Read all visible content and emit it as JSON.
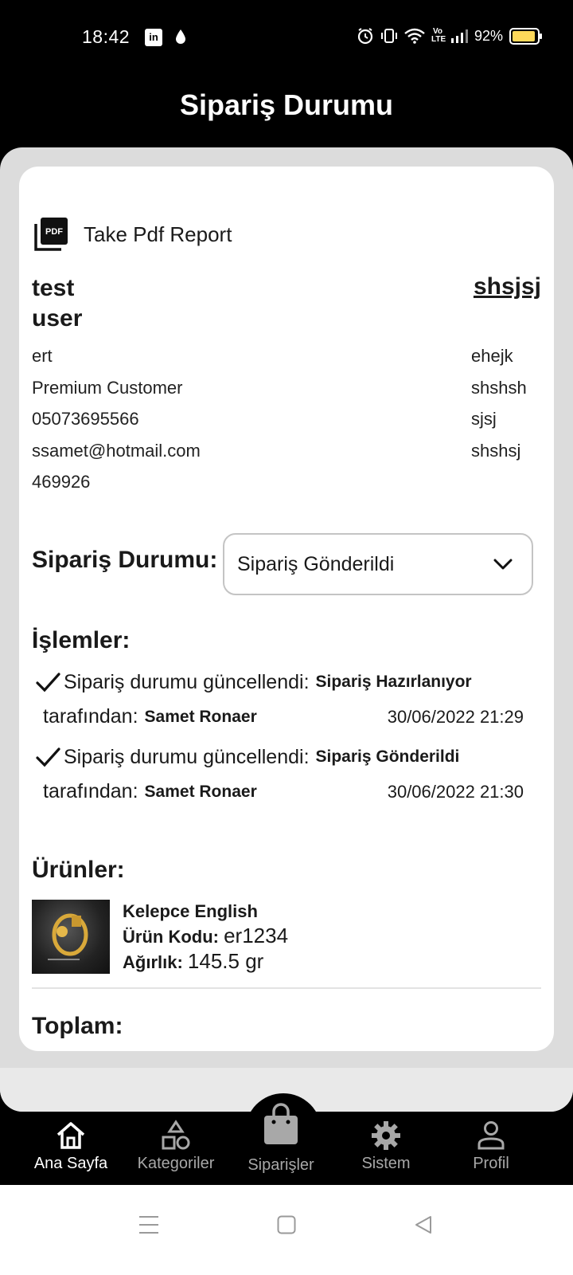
{
  "status_bar": {
    "time": "18:42",
    "linkedin_label": "in",
    "volte_label": "Vo LTE",
    "battery": "92%",
    "battery_level": 0.92,
    "battery_color": "#ffd95a"
  },
  "header": {
    "title": "Sipariş Durumu"
  },
  "pdf": {
    "label": "Take Pdf Report",
    "icon": "pdf-icon"
  },
  "customer": {
    "name": "test user",
    "right_title": "shsjsj",
    "left_lines": [
      "ert",
      "Premium Customer",
      "05073695566",
      "ssamet@hotmail.com",
      "469926"
    ],
    "right_lines": [
      "ehejk",
      "shshsh",
      "",
      "sjsj",
      "shshsj"
    ]
  },
  "order_status": {
    "label": "Sipariş Durumu:",
    "selected": "Sipariş Gönderildi"
  },
  "operations": {
    "title": "İşlemler:",
    "entries": [
      {
        "text": "Sipariş durumu güncellendi:",
        "status": "Sipariş Hazırlanıyor",
        "by_label": "tarafından:",
        "by": "Samet Ronaer",
        "date": "30/06/2022 21:29"
      },
      {
        "text": "Sipariş durumu güncellendi:",
        "status": "Sipariş Gönderildi",
        "by_label": "tarafından:",
        "by": "Samet Ronaer",
        "date": "30/06/2022 21:30"
      }
    ]
  },
  "products": {
    "title": "Ürünler:",
    "items": [
      {
        "name": "Kelepce English",
        "code_label": "Ürün Kodu:",
        "code": "er1234",
        "weight_label": "Ağırlık:",
        "weight": "145.5 gr"
      }
    ]
  },
  "total": {
    "title": "Toplam:"
  },
  "bottom_nav": {
    "items": [
      {
        "label": "Ana Sayfa",
        "icon": "home-icon",
        "active": true
      },
      {
        "label": "Kategoriler",
        "icon": "shapes-icon",
        "active": false
      },
      {
        "label": "Siparişler",
        "icon": "shopping-bag-icon",
        "active": false
      },
      {
        "label": "Sistem",
        "icon": "gear-icon",
        "active": false
      },
      {
        "label": "Profil",
        "icon": "person-icon",
        "active": false
      }
    ]
  },
  "system_nav": {
    "icons": [
      "menu-icon",
      "home-square-icon",
      "back-triangle-icon"
    ]
  }
}
